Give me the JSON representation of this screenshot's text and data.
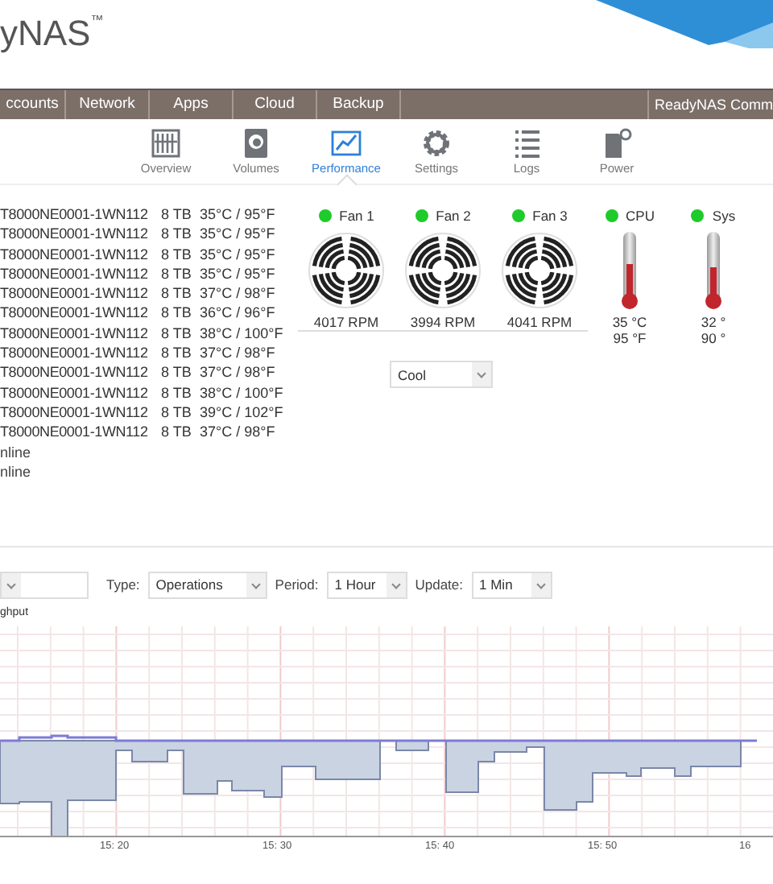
{
  "header": {
    "logo": "yNAS",
    "trademark": "™"
  },
  "nav": [
    {
      "label": "ccounts",
      "selected": false
    },
    {
      "label": "Network",
      "selected": false
    },
    {
      "label": "Apps",
      "selected": false
    },
    {
      "label": "Cloud",
      "selected": false
    },
    {
      "label": "Backup",
      "selected": false
    },
    {
      "label": "ReadyNAS Comm",
      "selected": false
    }
  ],
  "toolbar": [
    {
      "label": "Overview",
      "kind": "overview",
      "selected": false
    },
    {
      "label": "Volumes",
      "kind": "volumes",
      "selected": false
    },
    {
      "label": "Performance",
      "kind": "performance",
      "selected": true
    },
    {
      "label": "Settings",
      "kind": "settings",
      "selected": false
    },
    {
      "label": "Logs",
      "kind": "logs",
      "selected": false
    },
    {
      "label": "Power",
      "kind": "power",
      "selected": false
    }
  ],
  "disks": [
    {
      "model": "T8000NE0001-1WN112",
      "size": "8 TB",
      "temp": "35°C / 95°F"
    },
    {
      "model": "T8000NE0001-1WN112",
      "size": "8 TB",
      "temp": "35°C / 95°F"
    },
    {
      "model": "T8000NE0001-1WN112",
      "size": "8 TB",
      "temp": "35°C / 95°F"
    },
    {
      "model": "T8000NE0001-1WN112",
      "size": "8 TB",
      "temp": "35°C / 95°F"
    },
    {
      "model": "T8000NE0001-1WN112",
      "size": "8 TB",
      "temp": "37°C / 98°F"
    },
    {
      "model": "T8000NE0001-1WN112",
      "size": "8 TB",
      "temp": "36°C / 96°F"
    },
    {
      "model": "T8000NE0001-1WN112",
      "size": "8 TB",
      "temp": "38°C / 100°F"
    },
    {
      "model": "T8000NE0001-1WN112",
      "size": "8 TB",
      "temp": "37°C / 98°F"
    },
    {
      "model": "T8000NE0001-1WN112",
      "size": "8 TB",
      "temp": "37°C / 98°F"
    },
    {
      "model": "T8000NE0001-1WN112",
      "size": "8 TB",
      "temp": "38°C / 100°F"
    },
    {
      "model": "T8000NE0001-1WN112",
      "size": "8 TB",
      "temp": "39°C / 102°F"
    },
    {
      "model": "T8000NE0001-1WN112",
      "size": "8 TB",
      "temp": "37°C / 98°F"
    }
  ],
  "status_lines": [
    "nline",
    "nline"
  ],
  "fans": [
    {
      "name": "Fan 1",
      "ok": true,
      "reading": "4017 RPM"
    },
    {
      "name": "Fan 2",
      "ok": true,
      "reading": "3994 RPM"
    },
    {
      "name": "Fan 3",
      "ok": true,
      "reading": "4041 RPM"
    }
  ],
  "fan_mode": {
    "value": "Cool"
  },
  "sensors": [
    {
      "name": "CPU",
      "ok": true,
      "level": 0.5,
      "celsius": "35 °C",
      "fahrenheit": "95 °F"
    },
    {
      "name": "Sys",
      "ok": true,
      "level": 0.45,
      "celsius": "32 °",
      "fahrenheit": "90 °"
    }
  ],
  "graph_controls": [
    {
      "kind": "blank"
    },
    {
      "label": "Type:",
      "value": "Operations"
    },
    {
      "label": "Period:",
      "value": "1 Hour"
    },
    {
      "label": "Update:",
      "value": "1 Min"
    }
  ],
  "graph": {
    "title": "ghput",
    "x_labels": [
      "15: 20",
      "15: 30",
      "15: 40",
      "15: 50",
      "16"
    ]
  }
}
